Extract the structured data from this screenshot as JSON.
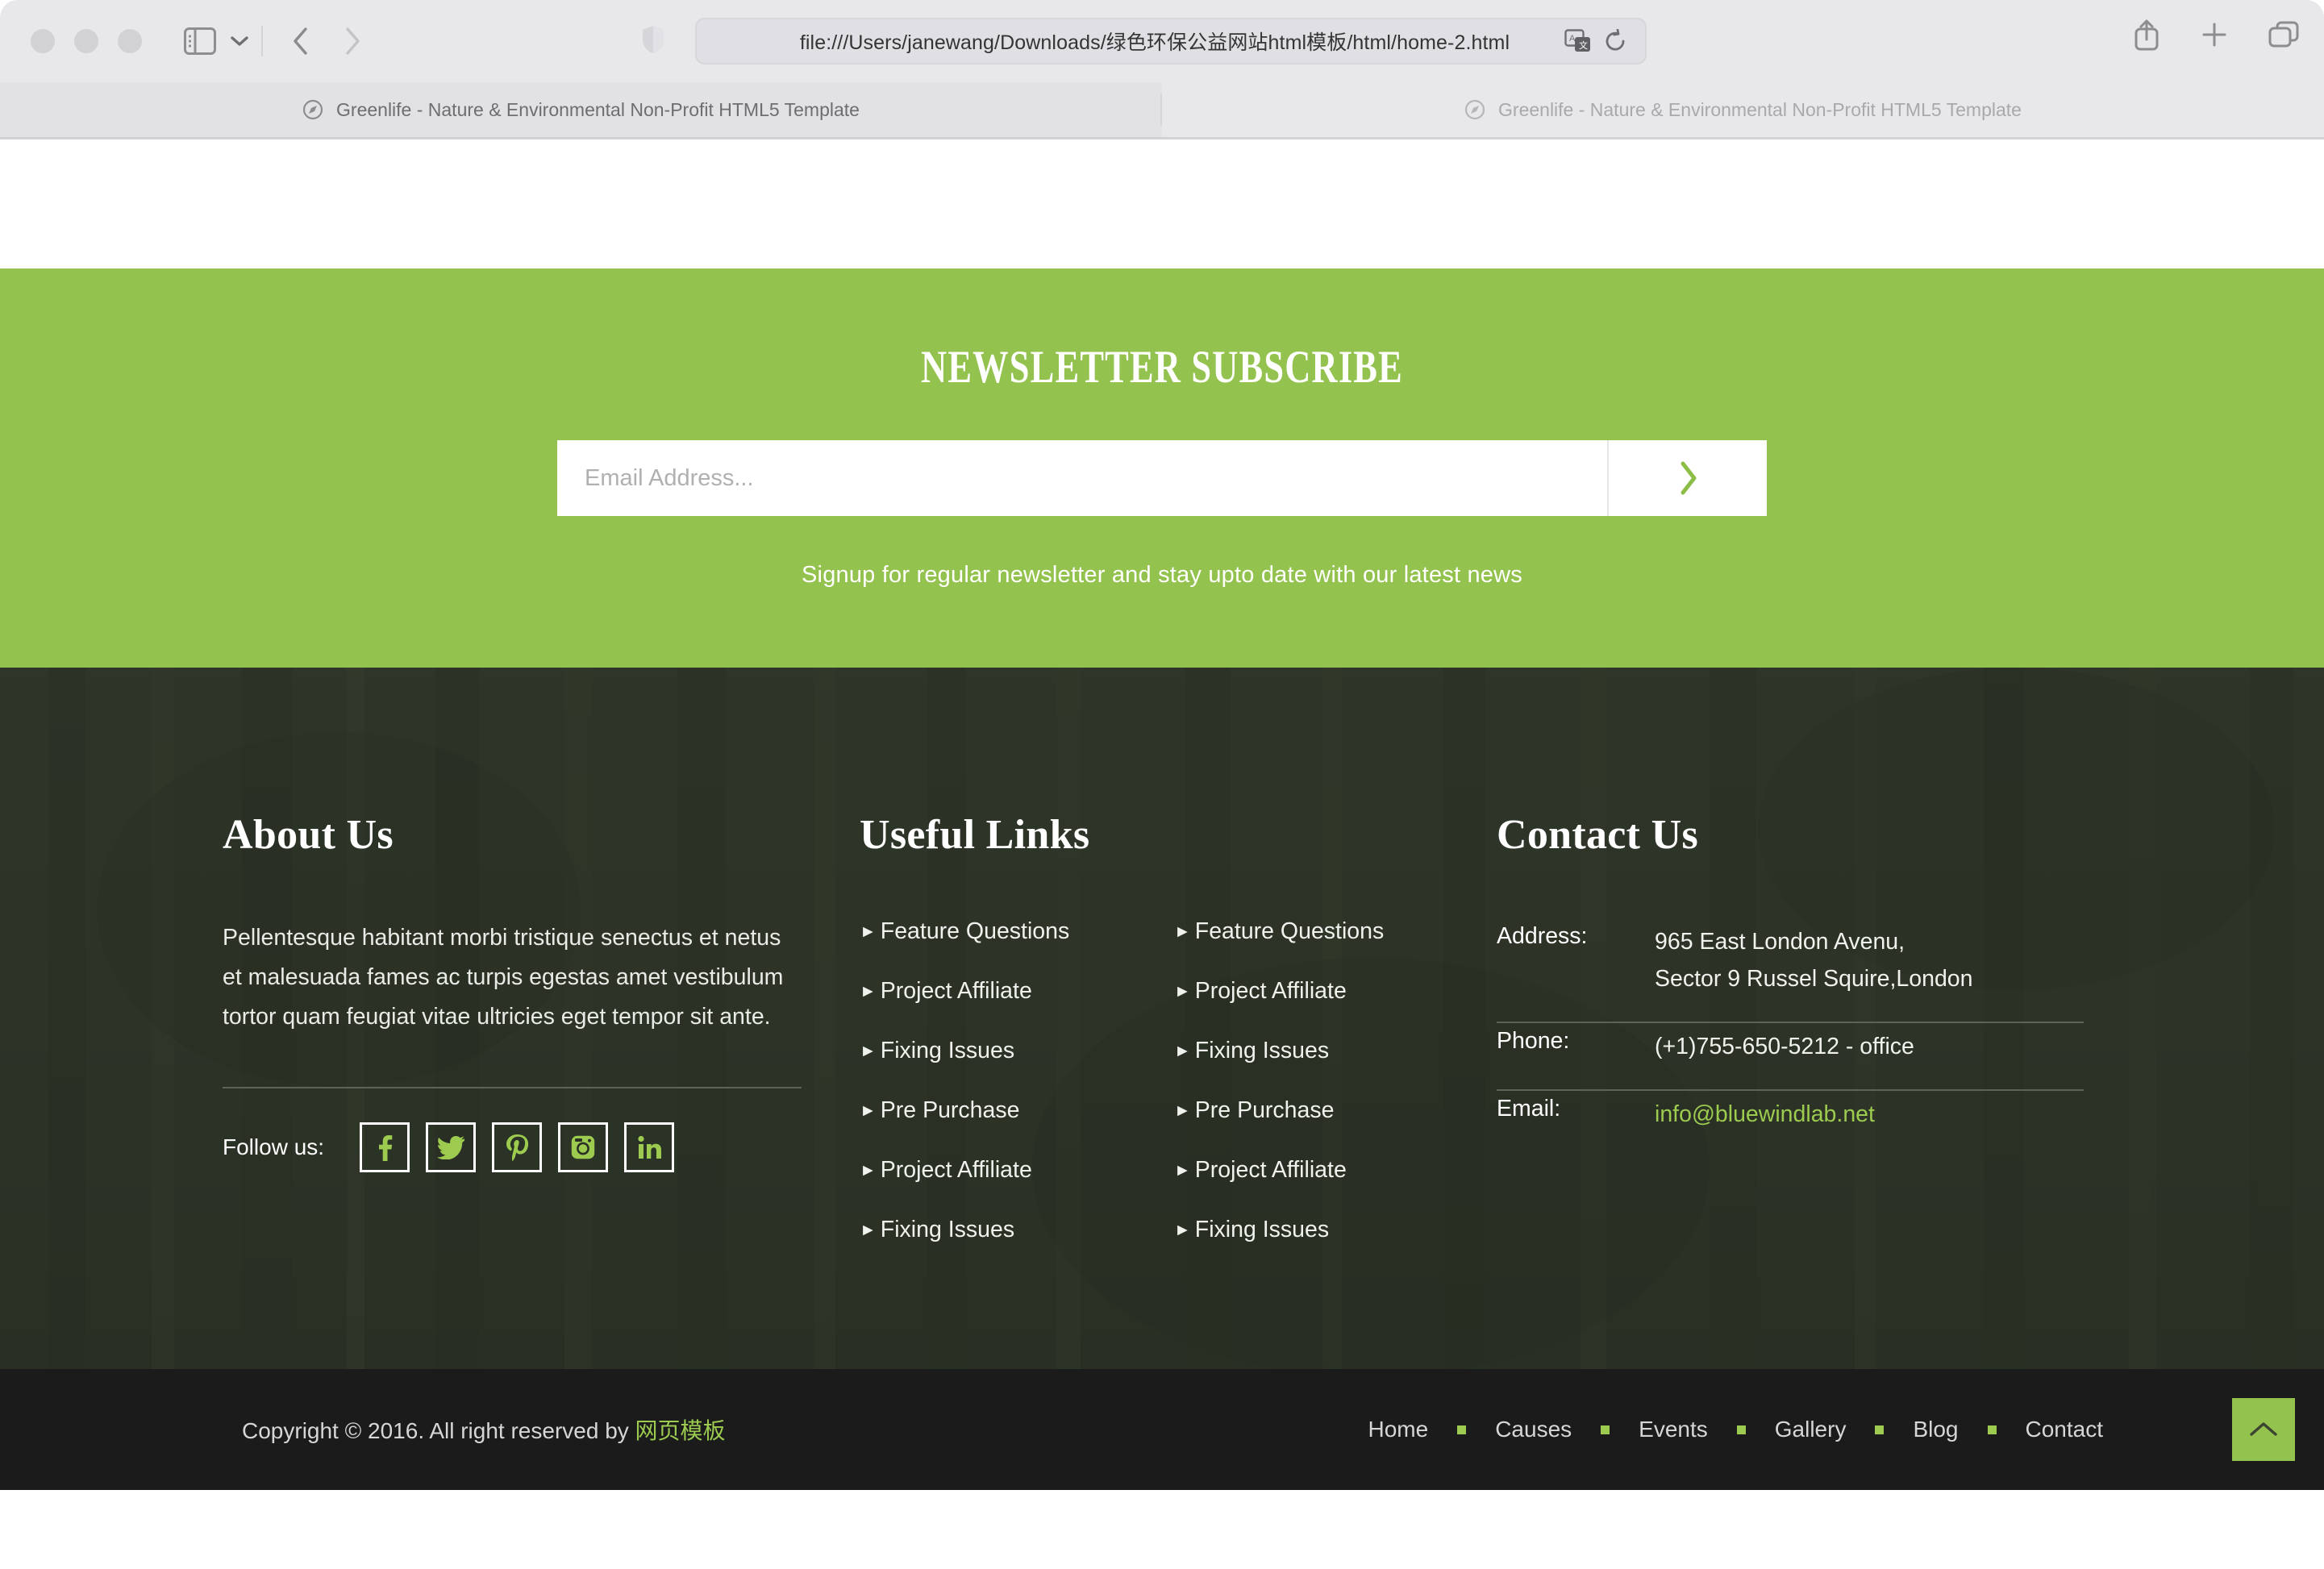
{
  "browser": {
    "url": "file:///Users/janewang/Downloads/绿色环保公益网站html模板/html/home-2.html",
    "traffic_lights": [
      "close",
      "minimize",
      "zoom"
    ],
    "icons": {
      "sidebar": "sidebar-icon",
      "sidebar_chevron": "chevron-down-icon",
      "back": "back-chevron-icon",
      "forward": "forward-chevron-icon",
      "shield": "privacy-shield-icon",
      "translate": "translate-icon",
      "reload": "reload-icon",
      "share": "share-icon",
      "new_tab": "plus-icon",
      "tab_overview": "tab-overview-icon"
    },
    "tabs": [
      {
        "title": "Greenlife - Nature & Environmental Non-Profit HTML5 Template",
        "active": true
      },
      {
        "title": "Greenlife - Nature & Environmental Non-Profit HTML5 Template",
        "active": false
      }
    ]
  },
  "newsletter": {
    "heading": "NEWSLETTER SUBSCRIBE",
    "email_placeholder": "Email Address...",
    "email_value": "",
    "submit_icon": "chevron-right-icon",
    "note": "Signup for regular newsletter and stay upto date with our latest news"
  },
  "footer": {
    "about": {
      "heading": "About Us",
      "text": "Pellentesque habitant morbi tristique senectus et netus et malesuada fames ac turpis egestas amet vestibulum tortor quam feugiat vitae ultricies eget tempor sit ante.",
      "follow_label": "Follow us:",
      "socials": [
        {
          "name": "facebook",
          "glyph": "f"
        },
        {
          "name": "twitter",
          "glyph": "t"
        },
        {
          "name": "pinterest",
          "glyph": "p"
        },
        {
          "name": "instagram",
          "glyph": "i"
        },
        {
          "name": "linkedin",
          "glyph": "in"
        }
      ]
    },
    "links": {
      "heading": "Useful Links",
      "column_one": [
        "Feature Questions",
        "Project Affiliate",
        "Fixing Issues",
        "Pre Purchase",
        "Project Affiliate",
        "Fixing Issues"
      ],
      "column_two": [
        "Feature Questions",
        "Project Affiliate",
        "Fixing Issues",
        "Pre Purchase",
        "Project Affiliate",
        "Fixing Issues"
      ]
    },
    "contact": {
      "heading": "Contact Us",
      "address_label": "Address:",
      "address_line1": "965 East London Avenu,",
      "address_line2": "Sector 9 Russel Squire,London",
      "phone_label": "Phone:",
      "phone_value": "(+1)755-650-5212 - office",
      "email_label": "Email:",
      "email_value": "info@bluewindlab.net"
    }
  },
  "copyright": {
    "text_prefix": "Copyright © 2016. All right reserved by ",
    "link_text": "网页模板",
    "nav": [
      "Home",
      "Causes",
      "Events",
      "Gallery",
      "Blog",
      "Contact"
    ],
    "to_top_icon": "chevron-up-icon"
  },
  "colors": {
    "brand_green": "#93c24e",
    "accent_green": "#9ccb4f",
    "footer_dark": "#2b3126",
    "copybar_dark": "#1b1b1b"
  }
}
